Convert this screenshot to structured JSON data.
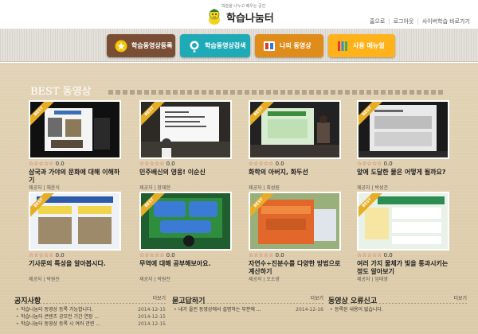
{
  "logo": {
    "tagline": "학습을 나누고 배우는 공간",
    "title": "학습나눔터"
  },
  "top_links": [
    "홈으로",
    "로그아웃",
    "사이버학습 바로가기"
  ],
  "nav": [
    {
      "label": "학습동영상등록",
      "icon": "star-icon",
      "color": "#7a4e35"
    },
    {
      "label": "학습동영상검색",
      "icon": "search-pin-icon",
      "color": "#1eaab6"
    },
    {
      "label": "나의 동영상",
      "icon": "film-icon",
      "color": "#e08c1a"
    },
    {
      "label": "사용 매뉴얼",
      "icon": "pencils-icon",
      "color": "#ffb21a"
    }
  ],
  "best": {
    "title": "BEST 동영상",
    "ribbon": "BEST",
    "writer_label": "제공자 | ",
    "items": [
      {
        "stars": "☆☆☆☆☆",
        "score": "0.0",
        "title": "삼국과 가야의 문화에 대해 이해하기",
        "author": "제공자 | 채윤식"
      },
      {
        "stars": "☆☆☆☆☆",
        "score": "0.0",
        "title": "민주배신의 영웅! 이순신",
        "author": "제공자 | 장재현"
      },
      {
        "stars": "☆☆☆☆☆",
        "score": "0.0",
        "title": "화학의 아버지, 화두선",
        "author": "제공자 | 최성원"
      },
      {
        "stars": "☆☆☆☆☆",
        "score": "0.0",
        "title": "앞에 도달한 물은 어떻게 될까요?",
        "author": "제공자 | 박성건"
      },
      {
        "stars": "☆☆☆☆☆",
        "score": "0.0",
        "title": "기사문의 특성을 알아봅시다.",
        "author": "제공자 | 박원진"
      },
      {
        "stars": "☆☆☆☆☆",
        "score": "0.0",
        "title": "무역에 대해 공부해보아요.",
        "author": "제공자 | 박원진"
      },
      {
        "stars": "☆☆☆☆☆",
        "score": "0.0",
        "title": "자연수÷진분수를 다양한 방법으로 계산하기",
        "author": "제공자 | 오소영"
      },
      {
        "stars": "☆☆☆☆☆",
        "score": "0.0",
        "title": "여러 가지 물체가 빛을 통과시키는 정도 알아보기",
        "author": "제공자 | 임태영"
      }
    ]
  },
  "notice": {
    "title": "공지사항",
    "more": "더보기",
    "items": [
      {
        "text": "학습나눔터 동영상 등록 가능합니다.",
        "date": "2014-12-15"
      },
      {
        "text": "학습나눔터 콘텐츠 공모전 기간 연장 ...",
        "date": "2014-12-15"
      },
      {
        "text": "학습나눔터 동영상 등록 시 여러 관련 ...",
        "date": "2014-12-15"
      }
    ]
  },
  "qna": {
    "title": "묻고답하기",
    "more": "더보기",
    "items": [
      {
        "text": "내가 올린 동영상에서 설명하는 부분에 ...",
        "date": "2014-12-16"
      }
    ]
  },
  "report": {
    "title": "동영상 오류신고",
    "more": "더보기",
    "items": [
      {
        "text": "등록된 내용이 없습니다.",
        "date": ""
      }
    ]
  }
}
